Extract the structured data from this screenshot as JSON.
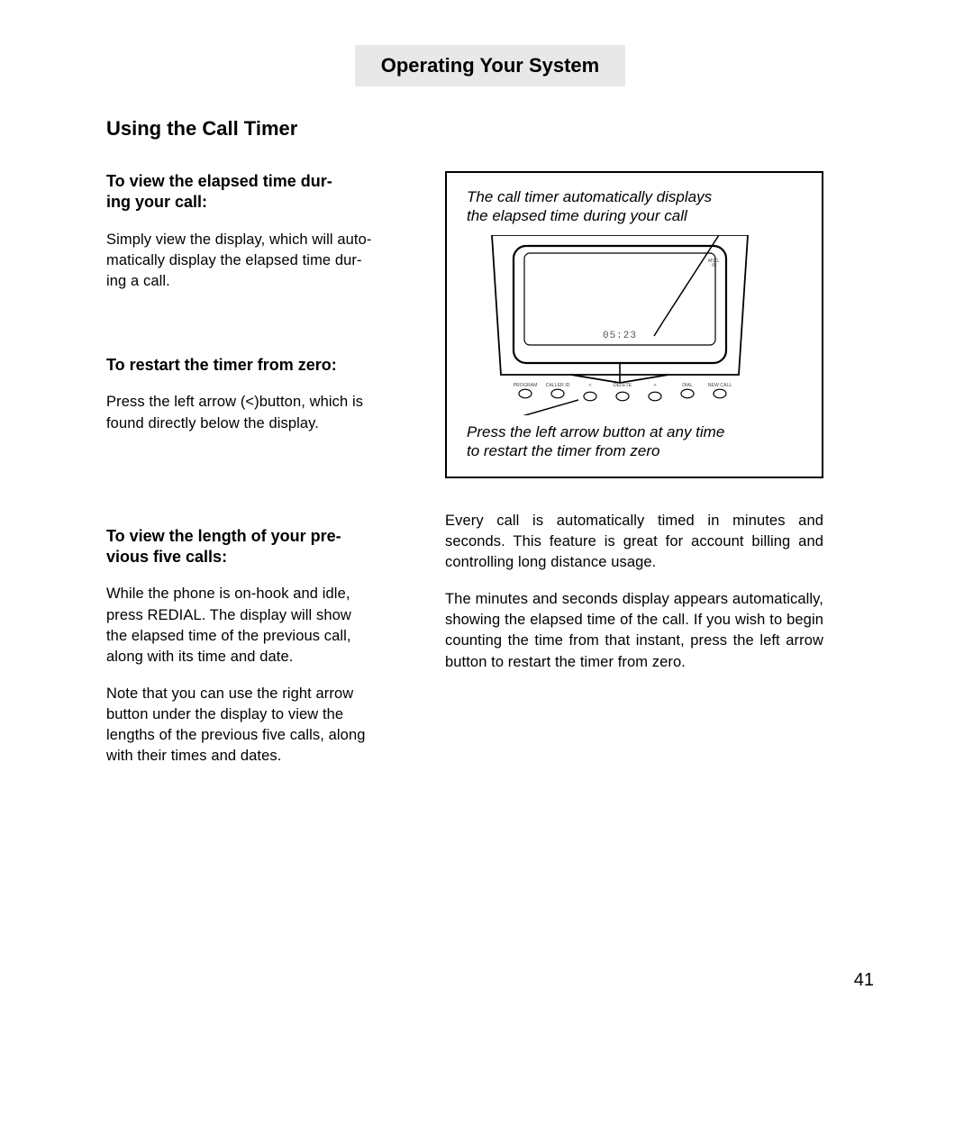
{
  "header": {
    "title": "Operating Your System"
  },
  "section": {
    "title": "Using the Call Timer"
  },
  "left": {
    "sub1_l1": "To view the elapsed time dur-",
    "sub1_l2": "ing your call:",
    "p1_l1": "Simply view the display, which will auto-",
    "p1_l2": "matically display the elapsed time dur-",
    "p1_l3": "ing a call.",
    "sub2": "To restart the timer from zero:",
    "p2_l1": "Press the left arrow (<)button, which is",
    "p2_l2": "found directly below the display.",
    "sub3_l1": "To view the length of your pre-",
    "sub3_l2": "vious five calls:",
    "p3_l1": "While the phone is on-hook and idle,",
    "p3_l2": "press REDIAL.  The display will show",
    "p3_l3": "the elapsed time of the previous call,",
    "p3_l4": "along with its time and date.",
    "p4_l1": "Note that you can use the right arrow",
    "p4_l2": "button under the display to view the",
    "p4_l3": "lengths of the previous five calls, along",
    "p4_l4": "with their times and dates."
  },
  "right": {
    "cap1_l1": "The call timer automatically displays",
    "cap1_l2": "the elapsed time during your call",
    "cap2_l1": "Press the left arrow button at any time",
    "cap2_l2": "to restart the timer from zero",
    "p5": "Every call is automatically timed in minutes and seconds.  This feature is great for account billing and controlling long distance usage.",
    "p6": "The minutes and seconds display appears automatically, showing the elapsed time of the call.  If you wish to begin counting the time from that instant, press the left arrow button to restart the timer from zero."
  },
  "figure": {
    "display_value": "05:23",
    "btn1": "PROGRAM",
    "btn2": "CALLER ID",
    "btn3": "<",
    "btn4": "DELETE",
    "btn5": ">",
    "btn6": "DIAL",
    "btn7": "NEW CALL",
    "msg": "MSG"
  },
  "page_number": "41"
}
